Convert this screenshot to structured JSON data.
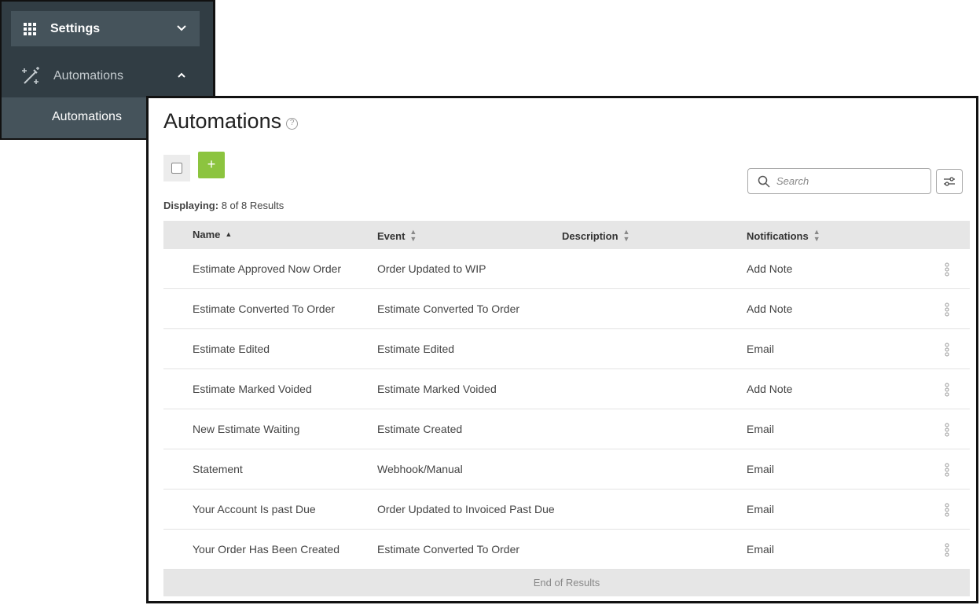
{
  "sidebar": {
    "settings_label": "Settings",
    "automations_label": "Automations",
    "sub_item_label": "Automations"
  },
  "main": {
    "title": "Automations",
    "search_placeholder": "Search",
    "displaying_label": "Displaying:",
    "displaying_value": "8 of 8 Results",
    "add_label": "+"
  },
  "table": {
    "columns": [
      "Name",
      "Event",
      "Description",
      "Notifications"
    ],
    "rows": [
      {
        "name": "Estimate Approved Now Order",
        "event": "Order Updated to WIP",
        "description": "",
        "notifications": "Add Note"
      },
      {
        "name": "Estimate Converted To Order",
        "event": "Estimate Converted To Order",
        "description": "",
        "notifications": "Add Note"
      },
      {
        "name": "Estimate Edited",
        "event": "Estimate Edited",
        "description": "",
        "notifications": "Email"
      },
      {
        "name": "Estimate Marked Voided",
        "event": "Estimate Marked Voided",
        "description": "",
        "notifications": "Add Note"
      },
      {
        "name": "New Estimate Waiting",
        "event": "Estimate Created",
        "description": "",
        "notifications": "Email"
      },
      {
        "name": "Statement",
        "event": "Webhook/Manual",
        "description": "",
        "notifications": "Email"
      },
      {
        "name": "Your Account Is past Due",
        "event": "Order Updated to Invoiced Past Due",
        "description": "",
        "notifications": "Email"
      },
      {
        "name": "Your Order Has Been Created",
        "event": "Estimate Converted To Order",
        "description": "",
        "notifications": "Email"
      }
    ],
    "footer": "End of Results"
  },
  "colors": {
    "sidebar_bg": "#313d44",
    "sidebar_active_bg": "#45535b",
    "add_button": "#8cc43f",
    "table_header_bg": "#e6e6e6"
  }
}
